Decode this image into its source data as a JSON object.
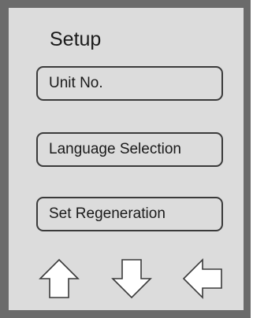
{
  "screen": {
    "title": "Setup",
    "menu": [
      {
        "label": "Unit No."
      },
      {
        "label": "Language Selection"
      },
      {
        "label": "Set Regeneration"
      }
    ],
    "nav": {
      "up_icon": "up-arrow-icon",
      "down_icon": "down-arrow-icon",
      "back_icon": "back-arrow-icon"
    }
  },
  "colors": {
    "bezel": "#6b6b6b",
    "screen": "#dcdcdc",
    "outline": "#3a3a3a",
    "text": "#1a1a1a"
  }
}
